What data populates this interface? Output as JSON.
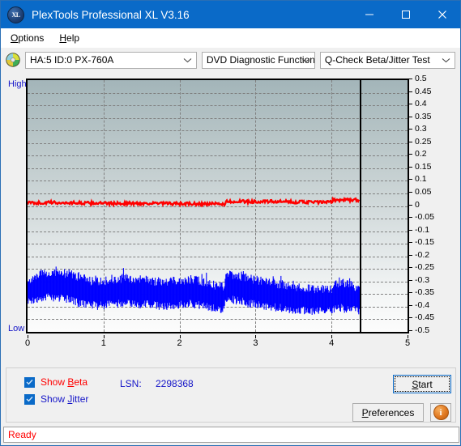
{
  "window": {
    "title": "PlexTools Professional XL V3.16",
    "icon": "xl-app-icon",
    "minimize_label": "minimize-icon",
    "maximize_label": "maximize-icon",
    "close_label": "close-icon"
  },
  "menubar": {
    "items": [
      {
        "label": "Options",
        "mnemonic": "O"
      },
      {
        "label": "Help",
        "mnemonic": "H"
      }
    ]
  },
  "toolbar": {
    "disc_icon": "optical-disc-icon",
    "drive": {
      "value": "HA:5 ID:0  PX-760A"
    },
    "function": {
      "value": "DVD Diagnostic Functions"
    },
    "test": {
      "value": "Q-Check Beta/Jitter Test"
    }
  },
  "chart_labels": {
    "high": "High",
    "low": "Low"
  },
  "controls": {
    "show_beta": {
      "label": "Show Beta",
      "mnemonic": "B",
      "checked": true,
      "color": "#ff0000"
    },
    "show_jitter": {
      "label": "Show Jitter",
      "mnemonic": "J",
      "checked": true,
      "color": "#1414c8"
    },
    "lsn_label": "LSN:",
    "lsn_value": "2298368",
    "start_button": {
      "label": "Start",
      "mnemonic": "S"
    },
    "preferences_button": {
      "label": "Preferences",
      "mnemonic": "P"
    },
    "info_button": {
      "label": "i",
      "name": "info-icon"
    }
  },
  "statusbar": {
    "text": "Ready"
  },
  "colors": {
    "titlebar": "#0a6ac8",
    "beta_series": "#ff0000",
    "jitter_series": "#0000ff",
    "plot_top": "#a3b5b9",
    "plot_bottom": "#fcfcfc",
    "gridline": "#808080",
    "accent_text": "#1414c8"
  },
  "chart_data": {
    "type": "line",
    "title": "Q-Check Beta/Jitter Test",
    "xlabel": "",
    "ylabel": "",
    "xlim": [
      0,
      5
    ],
    "ylim": [
      -0.5,
      0.5
    ],
    "xticks": [
      0,
      1,
      2,
      3,
      4,
      5
    ],
    "yticks": [
      0.5,
      0.45,
      0.4,
      0.35,
      0.3,
      0.25,
      0.2,
      0.15,
      0.1,
      0.05,
      0,
      -0.05,
      -0.1,
      -0.15,
      -0.2,
      -0.25,
      -0.3,
      -0.35,
      -0.4,
      -0.45,
      -0.5
    ],
    "ytick_labels": [
      "0.5",
      "0.45",
      "0.4",
      "0.35",
      "0.3",
      "0.25",
      "0.2",
      "0.15",
      "0.1",
      "0.05",
      "0",
      "-0.05",
      "-0.1",
      "-0.15",
      "-0.2",
      "-0.25",
      "-0.3",
      "-0.35",
      "-0.4",
      "-0.45",
      "-0.5"
    ],
    "grid": true,
    "legend_position": "bottom-left",
    "data_end_marker_x": 4.37,
    "series": [
      {
        "name": "Show Beta",
        "color": "#ff0000",
        "kind": "line",
        "x": [
          0.0,
          0.1,
          0.2,
          0.3,
          0.4,
          0.5,
          0.6,
          0.7,
          0.8,
          0.9,
          1.0,
          1.1,
          1.2,
          1.3,
          1.4,
          1.5,
          1.6,
          1.7,
          1.8,
          1.9,
          2.0,
          2.1,
          2.2,
          2.3,
          2.4,
          2.5,
          2.6,
          2.62,
          2.7,
          2.8,
          2.9,
          3.0,
          3.1,
          3.2,
          3.3,
          3.4,
          3.5,
          3.6,
          3.7,
          3.8,
          3.9,
          4.0,
          4.02,
          4.1,
          4.2,
          4.3,
          4.37
        ],
        "y": [
          0.012,
          0.013,
          0.012,
          0.014,
          0.013,
          0.012,
          0.013,
          0.012,
          0.011,
          0.012,
          0.01,
          0.01,
          0.01,
          0.011,
          0.01,
          0.01,
          0.011,
          0.01,
          0.01,
          0.009,
          0.009,
          0.009,
          0.008,
          0.008,
          0.008,
          0.008,
          0.008,
          0.018,
          0.018,
          0.018,
          0.017,
          0.018,
          0.017,
          0.018,
          0.017,
          0.017,
          0.016,
          0.016,
          0.016,
          0.015,
          0.015,
          0.015,
          0.024,
          0.024,
          0.024,
          0.024,
          0.024
        ]
      },
      {
        "name": "Show Jitter",
        "color": "#0000ff",
        "kind": "band",
        "x": [
          0.0,
          0.1,
          0.2,
          0.3,
          0.4,
          0.5,
          0.6,
          0.7,
          0.8,
          0.9,
          1.0,
          1.1,
          1.2,
          1.3,
          1.4,
          1.5,
          1.6,
          1.7,
          1.8,
          1.9,
          2.0,
          2.1,
          2.2,
          2.3,
          2.4,
          2.5,
          2.58,
          2.62,
          2.7,
          2.8,
          2.9,
          3.0,
          3.1,
          3.2,
          3.3,
          3.4,
          3.5,
          3.6,
          3.7,
          3.8,
          3.9,
          4.0,
          4.1,
          4.2,
          4.3,
          4.37
        ],
        "y_upper": [
          -0.305,
          -0.275,
          -0.27,
          -0.265,
          -0.262,
          -0.268,
          -0.275,
          -0.285,
          -0.295,
          -0.3,
          -0.3,
          -0.292,
          -0.288,
          -0.285,
          -0.29,
          -0.292,
          -0.296,
          -0.3,
          -0.302,
          -0.3,
          -0.296,
          -0.292,
          -0.292,
          -0.3,
          -0.31,
          -0.318,
          -0.32,
          -0.268,
          -0.272,
          -0.278,
          -0.288,
          -0.292,
          -0.3,
          -0.305,
          -0.31,
          -0.315,
          -0.32,
          -0.325,
          -0.328,
          -0.33,
          -0.332,
          -0.33,
          -0.3,
          -0.31,
          -0.32,
          -0.33
        ],
        "y_lower": [
          -0.382,
          -0.37,
          -0.366,
          -0.362,
          -0.362,
          -0.368,
          -0.378,
          -0.386,
          -0.392,
          -0.396,
          -0.396,
          -0.39,
          -0.386,
          -0.384,
          -0.388,
          -0.39,
          -0.392,
          -0.396,
          -0.398,
          -0.396,
          -0.392,
          -0.388,
          -0.39,
          -0.396,
          -0.402,
          -0.408,
          -0.41,
          -0.368,
          -0.372,
          -0.378,
          -0.386,
          -0.39,
          -0.396,
          -0.4,
          -0.404,
          -0.408,
          -0.412,
          -0.414,
          -0.416,
          -0.418,
          -0.418,
          -0.416,
          -0.404,
          -0.408,
          -0.412,
          -0.416
        ]
      }
    ]
  }
}
